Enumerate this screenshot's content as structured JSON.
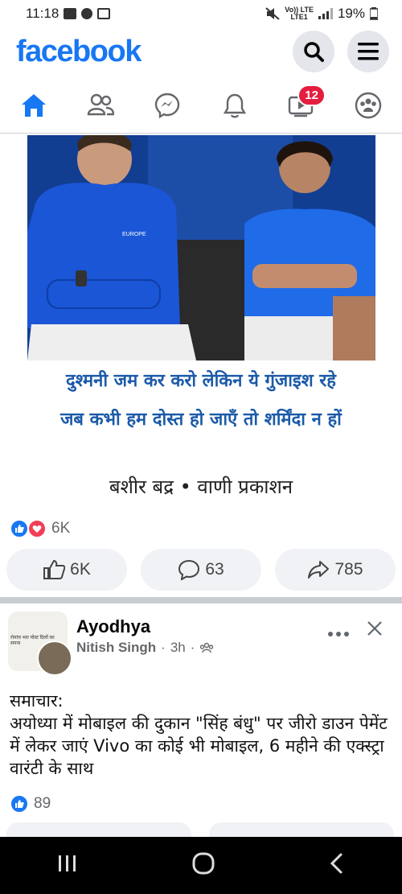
{
  "status": {
    "time": "11:18",
    "network_top": "Vo)) LTE",
    "network_bottom": "LTE1",
    "battery": "19%"
  },
  "header": {
    "logo": "facebook"
  },
  "nav": {
    "tabs": [
      "home-icon",
      "friends-icon",
      "messenger-icon",
      "notifications-icon",
      "video-icon",
      "groups-icon"
    ],
    "video_badge": "12"
  },
  "post1": {
    "image_text": "EUROPE",
    "quote_line1": "दुश्मनी जम कर करो लेकिन ये गुंजाइश रहे",
    "quote_line2": "जब कभी हम दोस्त हो जाएँ तो शर्मिंदा न हों",
    "attribution": "बशीर बद्र • वाणी प्रकाशन",
    "reactions_count": "6K",
    "like_count": "6K",
    "comment_count": "63",
    "share_count": "785"
  },
  "post2": {
    "group_avatar_text": "रोमांच भरा पोस्ट दिलों का सपना",
    "group_name": "Ayodhya",
    "author": "Nitish Singh",
    "time": "3h",
    "text_line1": "समाचार:",
    "text_line2": "अयोध्या में मोबाइल की दुकान \"सिंह बंधु\" पर जीरो डाउन पेमेंट में लेकर जाएं Vivo का कोई भी मोबाइल, 6 महीने की एक्स्ट्रा वारंटी के साथ",
    "reactions_count": "89"
  },
  "colors": {
    "brand": "#1877f2",
    "badge": "#e41e3f",
    "quote": "#1b5aa8"
  }
}
